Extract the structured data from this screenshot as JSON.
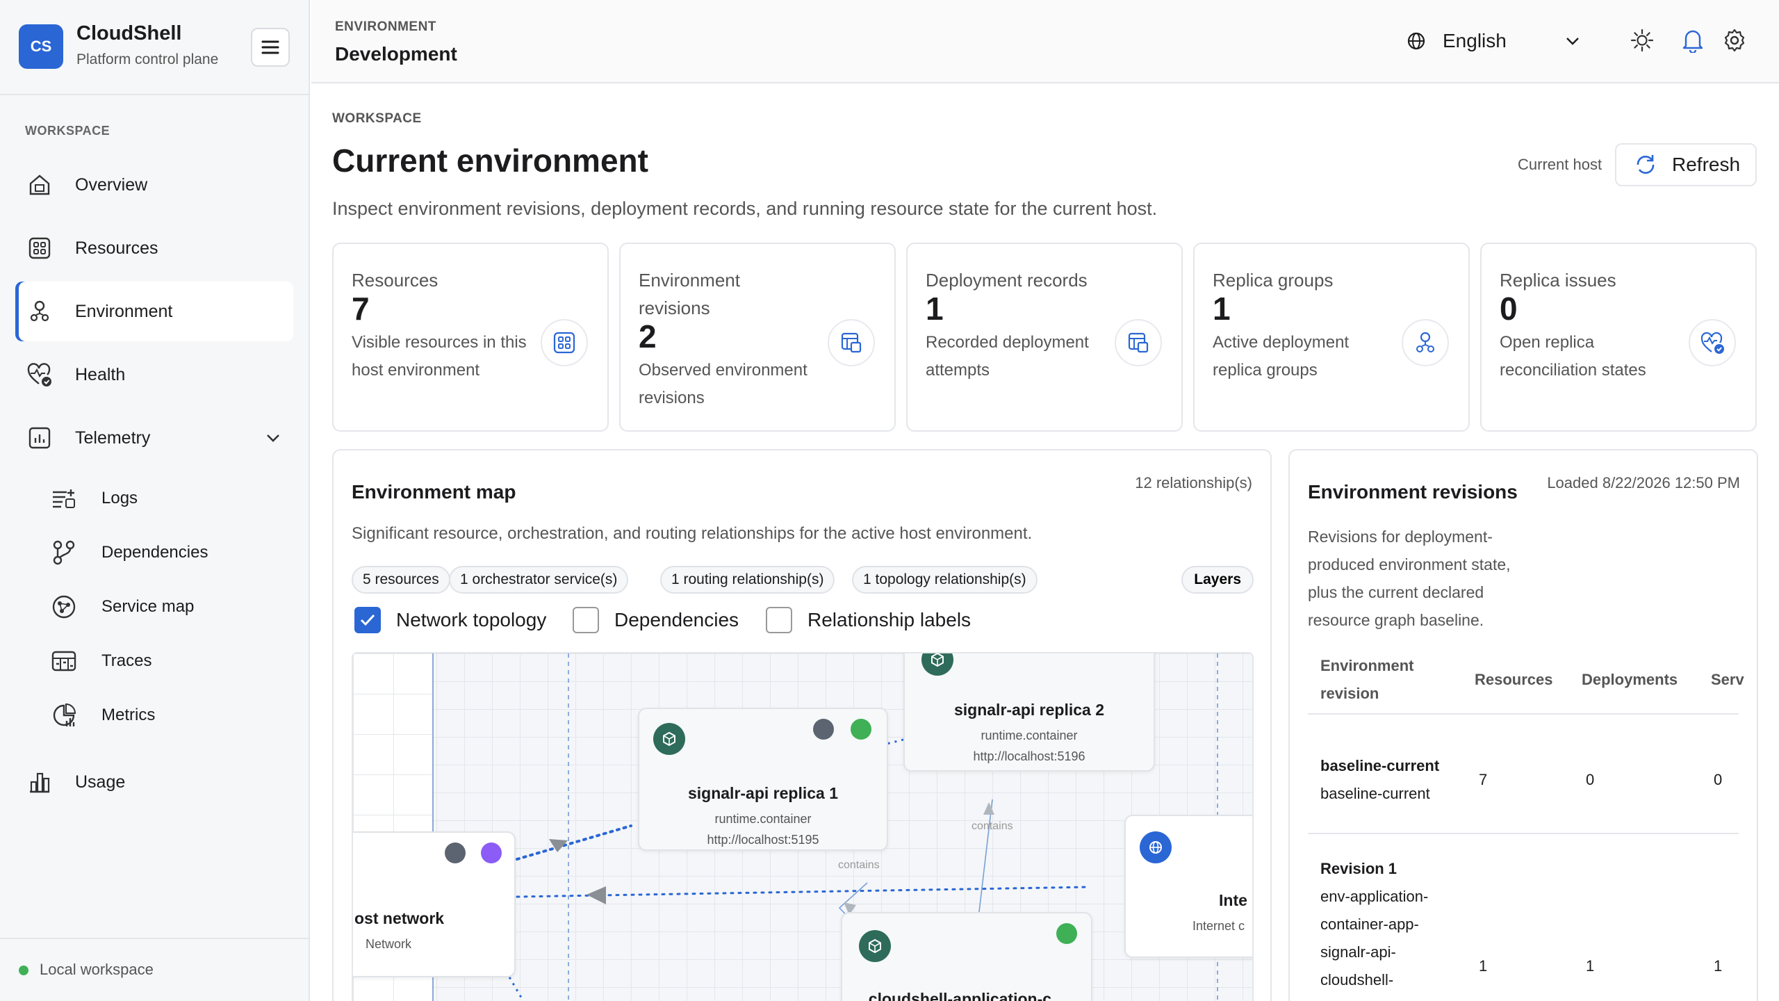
{
  "brand": {
    "logo": "CS",
    "name": "CloudShell",
    "subtitle": "Platform control plane"
  },
  "sidebar": {
    "section_label": "WORKSPACE",
    "items": [
      {
        "label": "Overview",
        "icon": "home-icon"
      },
      {
        "label": "Resources",
        "icon": "grid-icon"
      },
      {
        "label": "Environment",
        "icon": "environment-icon",
        "active": true
      },
      {
        "label": "Health",
        "icon": "heart-pulse-icon"
      },
      {
        "label": "Telemetry",
        "icon": "chart-icon",
        "expanded": true
      },
      {
        "label": "Usage",
        "icon": "usage-icon"
      }
    ],
    "telemetry_children": [
      {
        "label": "Logs",
        "icon": "logs-icon"
      },
      {
        "label": "Dependencies",
        "icon": "dependencies-icon"
      },
      {
        "label": "Service map",
        "icon": "service-map-icon"
      },
      {
        "label": "Traces",
        "icon": "traces-icon"
      },
      {
        "label": "Metrics",
        "icon": "metrics-icon"
      }
    ],
    "footer": {
      "label": "Local workspace",
      "status_color": "#3fb055"
    }
  },
  "topbar": {
    "caption": "ENVIRONMENT",
    "environment": "Development",
    "language": "English"
  },
  "page": {
    "section_label": "WORKSPACE",
    "title": "Current environment",
    "description": "Inspect environment revisions, deployment records, and running resource state for the current host.",
    "host_label": "Current host",
    "refresh_label": "Refresh"
  },
  "stats": [
    {
      "title": "Resources",
      "value": "7",
      "desc": "Visible resources in this host environment",
      "icon": "grid-icon"
    },
    {
      "title": "Environment revisions",
      "value": "2",
      "desc": "Observed environment revisions",
      "icon": "revisions-icon"
    },
    {
      "title": "Deployment records",
      "value": "1",
      "desc": "Recorded deployment attempts",
      "icon": "deployments-icon"
    },
    {
      "title": "Replica groups",
      "value": "1",
      "desc": "Active deployment replica groups",
      "icon": "replica-icon"
    },
    {
      "title": "Replica issues",
      "value": "0",
      "desc": "Open replica reconciliation states",
      "icon": "heart-check-icon"
    }
  ],
  "map": {
    "title": "Environment map",
    "count": "12 relationship(s)",
    "description": "Significant resource, orchestration, and routing relationships for the active host environment.",
    "chips": [
      "5 resources",
      "1 orchestrator service(s)",
      "1 routing relationship(s)",
      "1 topology relationship(s)"
    ],
    "layers_label": "Layers",
    "toggles": [
      {
        "label": "Network topology",
        "checked": true
      },
      {
        "label": "Dependencies",
        "checked": false
      },
      {
        "label": "Relationship labels",
        "checked": false
      }
    ],
    "nodes": [
      {
        "title": "signalr-api replica 1",
        "type": "runtime.container",
        "url": "http://localhost:5195"
      },
      {
        "title": "signalr-api replica 2",
        "type": "runtime.container",
        "url": "http://localhost:5196"
      },
      {
        "title": "ost network",
        "type": "Network"
      },
      {
        "title": "Inte",
        "type": "Internet c"
      },
      {
        "title": "cloudshell-application-c..."
      }
    ],
    "edge_labels": [
      "contains",
      "contains"
    ]
  },
  "revisions": {
    "title": "Environment revisions",
    "loaded": "Loaded 8/22/2026 12:50 PM",
    "description": "Revisions for deployment-produced environment state, plus the current declared resource graph baseline.",
    "columns": [
      "Environment revision",
      "Resources",
      "Deployments",
      "Serv"
    ],
    "rows": [
      {
        "name": "baseline-current",
        "sub": "baseline-current",
        "resources": "7",
        "deployments": "0",
        "services": "0"
      },
      {
        "name": "Revision 1",
        "sub": "env-application-container-app-signalr-api-cloudshell-",
        "resources": "1",
        "deployments": "1",
        "services": "1"
      }
    ]
  },
  "colors": {
    "accent": "#2a66d4",
    "node_icon": "#2e6b5a",
    "status_green": "#3fb055",
    "status_purple": "#8b5cf6"
  }
}
